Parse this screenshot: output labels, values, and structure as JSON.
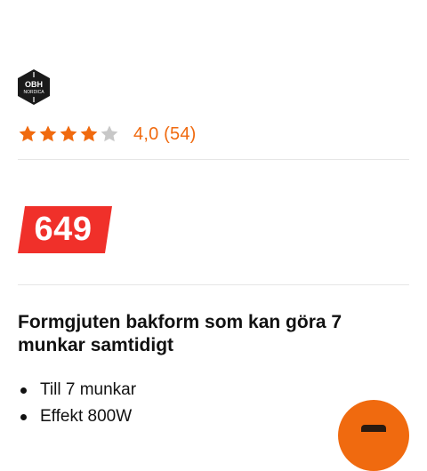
{
  "brand": {
    "logo_line1": "OBH",
    "logo_line2": "NORDICA"
  },
  "rating": {
    "value": 4.0,
    "max": 5,
    "text": "4,0 (54)",
    "star_color": "#f06a0f",
    "empty_star_color": "#c8c8c8"
  },
  "price": {
    "amount": "649",
    "badge_color": "#f0302a"
  },
  "product": {
    "title": "Formgjuten bakform som kan göra 7 munkar samtidigt",
    "features": [
      "Till 7 munkar",
      "Effekt 800W"
    ]
  },
  "fab": {
    "icon": "chat-icon",
    "color": "#f06a0f"
  }
}
